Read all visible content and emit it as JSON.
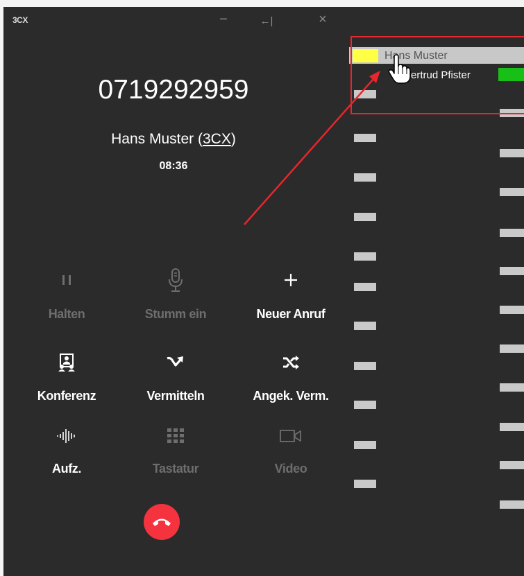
{
  "app": {
    "logo": "3CX"
  },
  "window_controls": {
    "minimize": "−",
    "collapse": "←|",
    "close": "×"
  },
  "call": {
    "number": "0719292959",
    "name": "Hans Muster",
    "name_open": " (",
    "name_link": "3CX",
    "name_close": ")",
    "duration": "08:36"
  },
  "actions": [
    {
      "id": "hold",
      "label": "Halten",
      "icon": "pause-icon",
      "enabled": false
    },
    {
      "id": "mute",
      "label": "Stumm ein",
      "icon": "microphone-icon",
      "enabled": false
    },
    {
      "id": "new_call",
      "label": "Neuer Anruf",
      "icon": "plus-icon",
      "enabled": true
    },
    {
      "id": "conference",
      "label": "Konferenz",
      "icon": "conference-icon",
      "enabled": true
    },
    {
      "id": "transfer",
      "label": "Vermitteln",
      "icon": "transfer-icon",
      "enabled": true
    },
    {
      "id": "attended_transfer",
      "label": "Angek. Verm.",
      "icon": "shuffle-icon",
      "enabled": true
    },
    {
      "id": "record",
      "label": "Aufz.",
      "icon": "waveform-icon",
      "enabled": true
    },
    {
      "id": "keypad",
      "label": "Tastatur",
      "icon": "keypad-icon",
      "enabled": false
    },
    {
      "id": "video",
      "label": "Video",
      "icon": "video-camera-icon",
      "enabled": false
    }
  ],
  "hangup": {
    "icon": "hang-up-icon"
  },
  "blf_panel": {
    "entries": [
      {
        "name": "Hans Muster",
        "status_color": "#ffff45"
      },
      {
        "name": "ertrud Pfister",
        "status_color": "#17bf17"
      }
    ]
  },
  "colors": {
    "background": "#2b2b2b",
    "hangup": "#f5333f",
    "highlight": "#e8262b",
    "disabled": "#6e6e6e"
  }
}
